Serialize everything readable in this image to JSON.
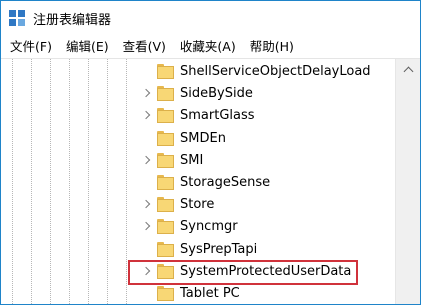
{
  "window": {
    "title": "注册表编辑器"
  },
  "menu": [
    "文件(F)",
    "编辑(E)",
    "查看(V)",
    "收藏夹(A)",
    "帮助(H)"
  ],
  "tree": {
    "items": [
      {
        "label": "ShellServiceObjectDelayLoad",
        "expandable": false,
        "selected": false
      },
      {
        "label": "SideBySide",
        "expandable": true,
        "selected": false
      },
      {
        "label": "SmartGlass",
        "expandable": true,
        "selected": false
      },
      {
        "label": "SMDEn",
        "expandable": false,
        "selected": false
      },
      {
        "label": "SMI",
        "expandable": true,
        "selected": false
      },
      {
        "label": "StorageSense",
        "expandable": false,
        "selected": false
      },
      {
        "label": "Store",
        "expandable": true,
        "selected": false
      },
      {
        "label": "Syncmgr",
        "expandable": true,
        "selected": false
      },
      {
        "label": "SysPrepTapi",
        "expandable": false,
        "selected": false
      },
      {
        "label": "SystemProtectedUserData",
        "expandable": true,
        "selected": true
      },
      {
        "label": "Tablet PC",
        "expandable": false,
        "selected": false
      }
    ]
  },
  "colors": {
    "accent_border": "#1f84c9",
    "folder": "#f8d775",
    "highlight": "#d0323b"
  },
  "icons": {
    "app": "regedit-icon",
    "folder": "folder-icon",
    "expander": "chevron-right-icon",
    "scroll_up": "chevron-up-icon"
  }
}
